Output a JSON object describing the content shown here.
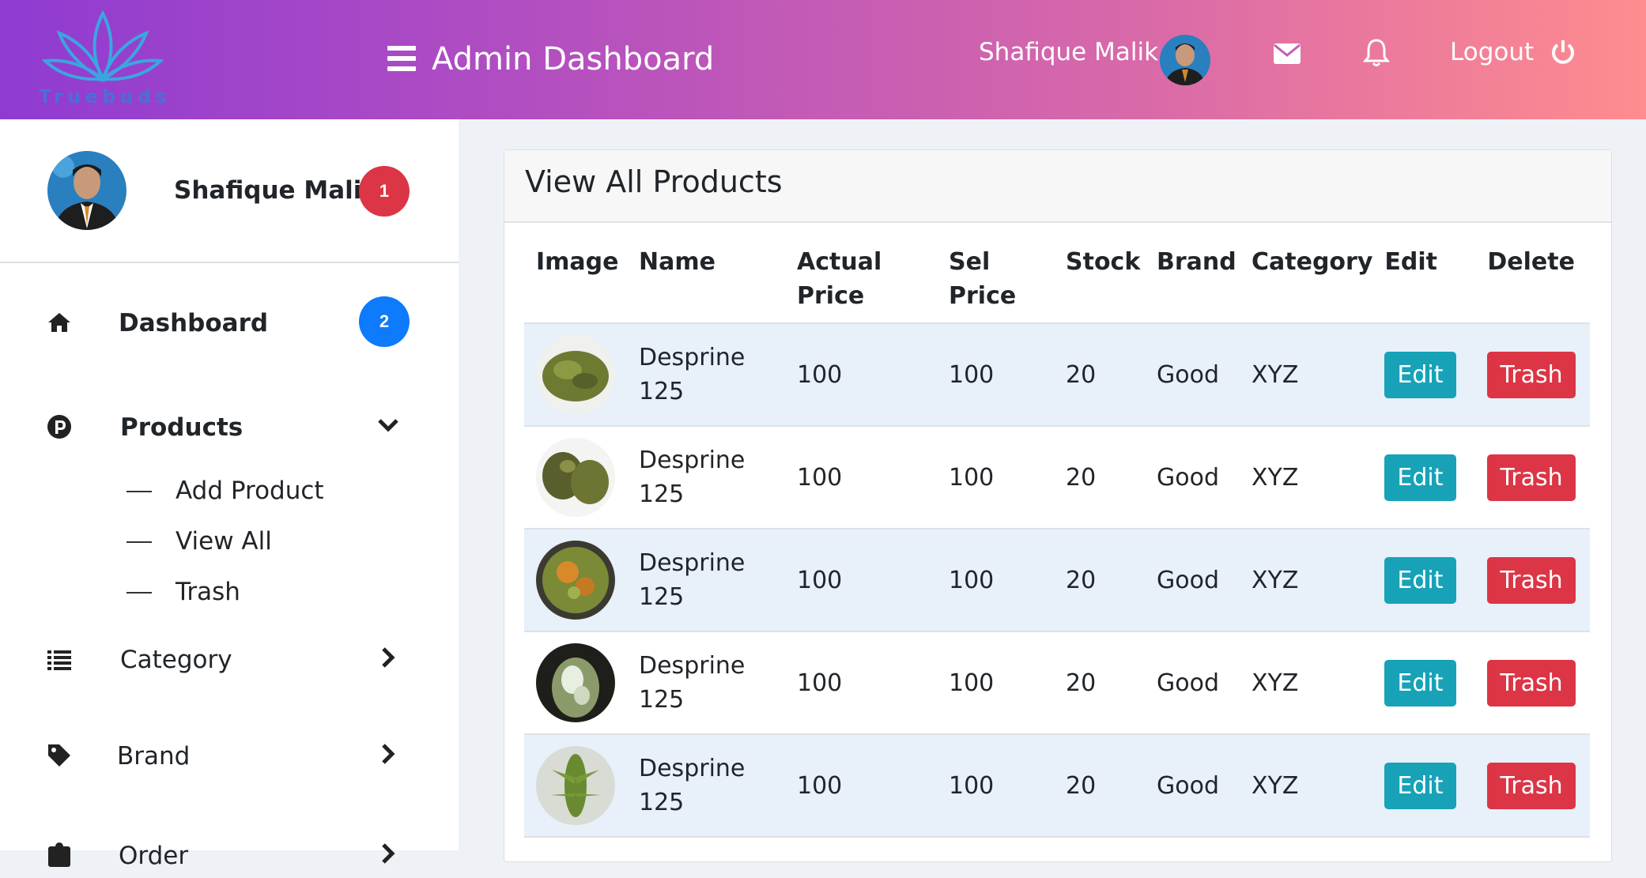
{
  "header": {
    "logo_text": "Truebuds",
    "app_title": "Admin Dashboard",
    "user_name": "Shafique Malik",
    "logout_label": "Logout",
    "icons": [
      "menu-icon",
      "envelope-icon",
      "bell-icon",
      "power-icon"
    ]
  },
  "sidebar": {
    "profile_name": "Shafique Malik",
    "profile_badge": "1",
    "items": [
      {
        "label": "Dashboard",
        "icon": "home-icon",
        "badge": "2"
      },
      {
        "label": "Products",
        "icon": "p-circle-icon",
        "expanded": true,
        "subitems": [
          "Add Product",
          "View All",
          "Trash"
        ]
      },
      {
        "label": "Category",
        "icon": "list-icon"
      },
      {
        "label": "Brand",
        "icon": "tag-icon"
      },
      {
        "label": "Order",
        "icon": "order-icon"
      }
    ]
  },
  "main": {
    "card_title": "View All Products",
    "columns": [
      "Image",
      "Name",
      "Actual Price",
      "Sel Price",
      "Stock",
      "Brand",
      "Category",
      "Edit",
      "Delete"
    ],
    "rows": [
      {
        "name": "Desprine 125",
        "actual_price": "100",
        "sel_price": "100",
        "stock": "20",
        "brand": "Good",
        "category": "XYZ",
        "edit": "Edit",
        "delete": "Trash"
      },
      {
        "name": "Desprine 125",
        "actual_price": "100",
        "sel_price": "100",
        "stock": "20",
        "brand": "Good",
        "category": "XYZ",
        "edit": "Edit",
        "delete": "Trash"
      },
      {
        "name": "Desprine 125",
        "actual_price": "100",
        "sel_price": "100",
        "stock": "20",
        "brand": "Good",
        "category": "XYZ",
        "edit": "Edit",
        "delete": "Trash"
      },
      {
        "name": "Desprine 125",
        "actual_price": "100",
        "sel_price": "100",
        "stock": "20",
        "brand": "Good",
        "category": "XYZ",
        "edit": "Edit",
        "delete": "Trash"
      },
      {
        "name": "Desprine 125",
        "actual_price": "100",
        "sel_price": "100",
        "stock": "20",
        "brand": "Good",
        "category": "XYZ",
        "edit": "Edit",
        "delete": "Trash"
      }
    ]
  },
  "colors": {
    "header_gradient": [
      "#8f3bd2",
      "#ff8c8e"
    ],
    "edit_button": "#17a2b8",
    "trash_button": "#dc3545",
    "badge_red": "#dc3545",
    "badge_blue": "#0d7bfb",
    "striped_row": "#e8f0fa"
  }
}
